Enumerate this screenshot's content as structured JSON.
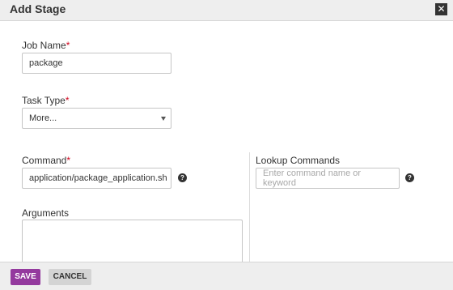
{
  "dialog": {
    "title": "Add Stage",
    "close_icon": "close-icon"
  },
  "job_name": {
    "label": "Job Name",
    "required_mark": "*",
    "value": "package"
  },
  "task_type": {
    "label": "Task Type",
    "required_mark": "*",
    "selected": "More..."
  },
  "command": {
    "label": "Command",
    "required_mark": "*",
    "value": "application/package_application.sh",
    "help_icon": "help-icon",
    "help_glyph": "?"
  },
  "lookup": {
    "label": "Lookup Commands",
    "placeholder": "Enter command name or keyword",
    "help_icon": "help-icon",
    "help_glyph": "?"
  },
  "arguments": {
    "label": "Arguments",
    "value": ""
  },
  "footer": {
    "save_label": "SAVE",
    "cancel_label": "CANCEL"
  },
  "colors": {
    "accent": "#943a9e",
    "required": "#d0021b"
  }
}
